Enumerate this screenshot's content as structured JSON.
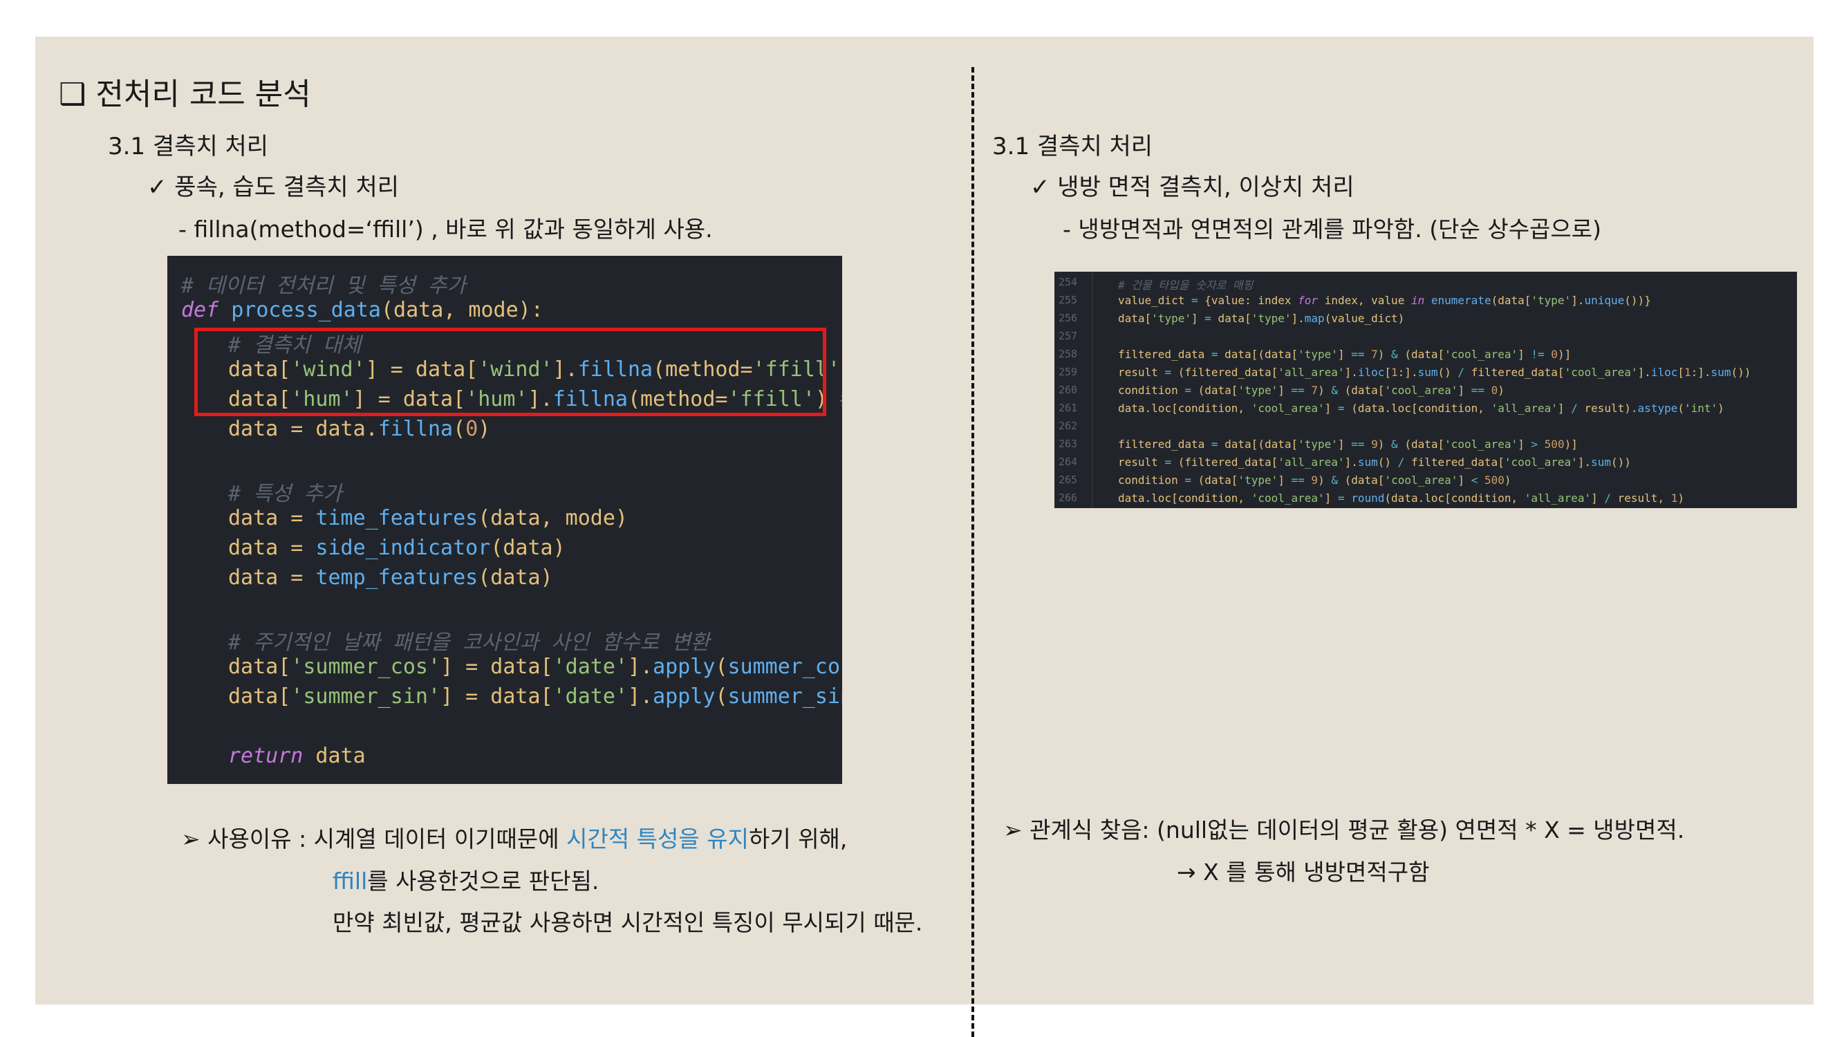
{
  "left": {
    "title": "❑ 전처리 코드 분석",
    "section": "3.1 결측치 처리",
    "subsection": "✓ 풍속, 습도 결측치 처리",
    "description": "- fillna(method=‘ffill’)  , 바로 위 값과 동일하게 사용.",
    "code": {
      "l1": "# 데이터 전처리 및 특성 추가",
      "l2_def": "def",
      "l2_fn": "process_data",
      "l2_args": "(data, mode):",
      "l3": "# 결측치 대체",
      "l4_a": "data[",
      "l4_b": "'wind'",
      "l4_c": "] = data[",
      "l4_d": "'wind'",
      "l4_e": "].",
      "l4_f": "fillna",
      "l4_g": "(method=",
      "l4_h": "'ffill'",
      "l4_i": ")",
      "l4_j": " #",
      "l5_a": "data[",
      "l5_b": "'hum'",
      "l5_c": "] = data[",
      "l5_d": "'hum'",
      "l5_e": "].",
      "l5_f": "fillna",
      "l5_g": "(method=",
      "l5_h": "'ffill'",
      "l5_i": ")",
      "l5_j": " # m",
      "l6_a": "data = data.",
      "l6_b": "fillna",
      "l6_c": "(",
      "l6_d": "0",
      "l6_e": ")",
      "l7": "# 특성 추가",
      "l8_a": "data = ",
      "l8_b": "time_features",
      "l8_c": "(data, mode)",
      "l9_a": "data = ",
      "l9_b": "side_indicator",
      "l9_c": "(data)",
      "l10_a": "data = ",
      "l10_b": "temp_features",
      "l10_c": "(data)",
      "l11": "# 주기적인 날짜 패턴을 코사인과 사인 함수로 변환",
      "l12_a": "data[",
      "l12_b": "'summer_cos'",
      "l12_c": "] = data[",
      "l12_d": "'date'",
      "l12_e": "].",
      "l12_f": "apply",
      "l12_g": "(",
      "l12_h": "summer_cos",
      "l12_i": ")",
      "l13_a": "data[",
      "l13_b": "'summer_sin'",
      "l13_c": "] = data[",
      "l13_d": "'date'",
      "l13_e": "].",
      "l13_f": "apply",
      "l13_g": "(",
      "l13_h": "summer_sin",
      "l13_i": ")",
      "l14_a": "return",
      "l14_b": " data"
    },
    "reason_prefix": "➢ 사용이유 : 시계열 데이터 이기때문에 ",
    "reason_highlight": "시간적 특성을 유지",
    "reason_suffix": "하기 위해,",
    "reason2_highlight": "ffill",
    "reason2_suffix": "를 사용한것으로 판단됨.",
    "reason3": "만약 최빈값, 평균값 사용하면 시간적인 특징이 무시되기 때문."
  },
  "right": {
    "section": "3.1 결측치 처리",
    "subsection": "✓ 냉방 면적 결측치, 이상치 처리",
    "description": "- 냉방면적과 연면적의 관계를 파악함. (단순 상수곱으로)",
    "code_lines": [
      {
        "num": "254",
        "text": "# 건물 타입을 숫자로 매핑"
      },
      {
        "num": "255",
        "text": "value_dict = {value: index for index, value in enumerate(data['type'].unique())}"
      },
      {
        "num": "256",
        "text": "data['type'] = data['type'].map(value_dict)"
      },
      {
        "num": "257",
        "text": ""
      },
      {
        "num": "258",
        "text": "filtered_data = data[(data['type'] == 7) & (data['cool_area'] != 0)]"
      },
      {
        "num": "259",
        "text": "result = (filtered_data['all_area'].iloc[1:].sum() / filtered_data['cool_area'].iloc[1:].sum())"
      },
      {
        "num": "260",
        "text": "condition = (data['type'] == 7) & (data['cool_area'] == 0)"
      },
      {
        "num": "261",
        "text": "data.loc[condition, 'cool_area'] = (data.loc[condition, 'all_area'] / result).astype('int')"
      },
      {
        "num": "262",
        "text": ""
      },
      {
        "num": "263",
        "text": "filtered_data = data[(data['type'] == 9) & (data['cool_area'] > 500)]"
      },
      {
        "num": "264",
        "text": "result = (filtered_data['all_area'].sum() / filtered_data['cool_area'].sum())"
      },
      {
        "num": "265",
        "text": "condition = (data['type'] == 9) & (data['cool_area'] < 500)"
      },
      {
        "num": "266",
        "text": "data.loc[condition, 'cool_area'] = round(data.loc[condition, 'all_area'] / result, 1)"
      }
    ],
    "relation": "➢ 관계식 찾음: (null없는 데이터의 평균 활용) 연면적 * X = 냉방면적.",
    "relation2": "→ X 를 통해 냉방면적구함"
  }
}
